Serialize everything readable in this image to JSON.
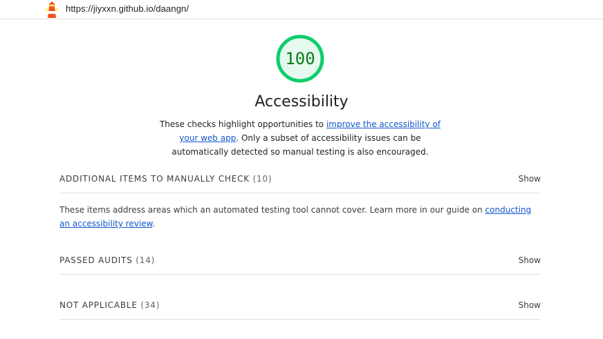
{
  "topbar": {
    "url": "https://jiyxxn.github.io/daangn/",
    "logo_icon": "lighthouse-icon"
  },
  "category": {
    "score": "100",
    "score_color": "#0cce6b",
    "score_bg": "#e5f9ee",
    "title": "Accessibility",
    "description": {
      "pre": "These checks highlight opportunities to ",
      "link": "improve the accessibility of your web app",
      "post": ". Only a subset of accessibility issues can be automatically detected so manual testing is also encouraged."
    }
  },
  "groups": [
    {
      "label": "Additional items to manually check",
      "count": "(10)",
      "toggle": "Show"
    },
    {
      "label": "Passed audits",
      "count": "(14)",
      "toggle": "Show"
    },
    {
      "label": "Not applicable",
      "count": "(34)",
      "toggle": "Show"
    }
  ],
  "manual_note": {
    "pre": "These items address areas which an automated testing tool cannot cover. Learn more in our guide on ",
    "link": "conducting an accessibility review",
    "post": "."
  }
}
